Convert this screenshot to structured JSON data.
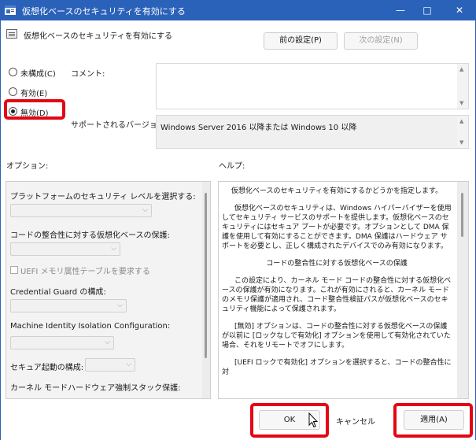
{
  "window": {
    "title": "仮想化ベースのセキュリティを有効にする",
    "minimize_glyph": "—",
    "maximize_glyph": "□",
    "close_glyph": "✕"
  },
  "policy": {
    "name": "仮想化ベースのセキュリティを有効にする"
  },
  "nav": {
    "prev_label": "前の設定(P)",
    "next_label": "次の設定(N)"
  },
  "state": {
    "options": [
      {
        "label": "未構成(C)",
        "selected": false
      },
      {
        "label": "有効(E)",
        "selected": false
      },
      {
        "label": "無効(D)",
        "selected": true
      }
    ]
  },
  "comment": {
    "label": "コメント:"
  },
  "supported": {
    "label": "サポートされるバージョン:",
    "value": "Windows Server 2016 以降または Windows 10 以降"
  },
  "options_section": {
    "label": "オプション:",
    "items": {
      "platform_security": "プラットフォームのセキュリティ レベルを選択する:",
      "code_integrity": "コードの整合性に対する仮想化ベースの保護:",
      "uefi_checkbox": "UEFI メモリ属性テーブルを要求する",
      "credential_guard": "Credential  Guard の構成:",
      "machine_identity": "Machine Identity Isolation Configuration:",
      "secure_launch": "セキュア起動の構成:",
      "kernel_stack": "カーネル モードハードウェア強制スタック保護:"
    }
  },
  "help_section": {
    "label": "ヘルプ:",
    "paragraphs": [
      "仮想化ベースのセキュリティを有効にするかどうかを指定します。",
      "仮想化ベースのセキュリティは、Windows ハイパーバイザーを使用してセキュリティ サービスのサポートを提供します。仮想化ベースのセキュリティにはセキュア ブートが必要です。オプションとして DMA 保護を使用して有効にすることができます。DMA 保護はハードウェア サポートを必要とし、正しく構成されたデバイスでのみ有効になります。",
      "コードの整合性に対する仮想化ベースの保護",
      "この設定により、カーネル モード コードの整合性に対する仮想化ベースの保護が有効になります。これが有効にされると、カーネル モードのメモリ保護が適用され、コード整合性検証パスが仮想化ベースのセキュリティ機能によって保護されます。",
      "[無効] オプションは、コードの整合性に対する仮想化ベースの保護が以前に [ロックなしで有効化] オプションを使用して有効化されていた場合、それをリモートでオフにします。",
      "[UEFI ロックで有効化] オプションを選択すると、コードの整合性に対"
    ]
  },
  "footer": {
    "ok_label": "OK",
    "cancel_label": "キャンセル",
    "apply_label": "適用(A)"
  },
  "colors": {
    "titlebar": "#2b62b9",
    "highlight": "#e30613"
  }
}
